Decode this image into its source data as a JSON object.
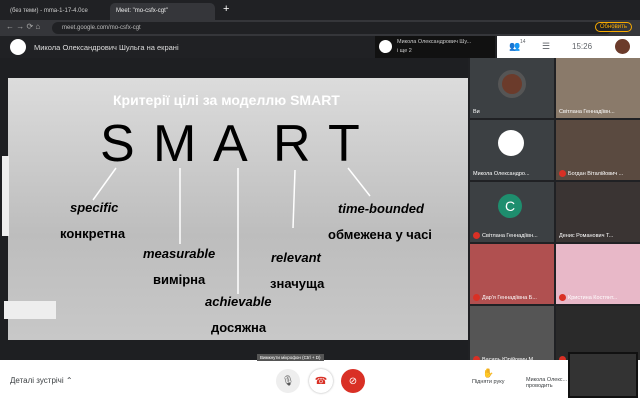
{
  "browser": {
    "tabs": [
      {
        "label": "(без теми) - mma-1-17-4.0ce"
      },
      {
        "label": "Meet: \"mo-csfx-cgt\""
      }
    ],
    "url": "meet.google.com/mo-csfx-cgt",
    "update_label": "Обновить"
  },
  "meet": {
    "presenter_banner": "Микола Олександрович Шульга на екрані",
    "presenting_name": "Микола Олександрович Шу...",
    "presenting_sub": "і ще 2",
    "participant_count": "14",
    "time": "15:26",
    "self_label": "Ви"
  },
  "slide": {
    "title": "Критерії цілі за моделлю SMART",
    "letters": [
      "S",
      "M",
      "A",
      "R",
      "T"
    ],
    "terms": [
      {
        "en": "specific",
        "ua": "конкретна"
      },
      {
        "en": "measurable",
        "ua": "вимірна"
      },
      {
        "en": "achievable",
        "ua": "досяжна"
      },
      {
        "en": "relevant",
        "ua": "значуща"
      },
      {
        "en": "time-bounded",
        "ua": "обмежена у часі"
      }
    ]
  },
  "participants": [
    {
      "name": "Ви",
      "type": "avatar"
    },
    {
      "name": "Світлана Геннадіївн...",
      "type": "video"
    },
    {
      "name": "Микола Олександро...",
      "type": "logo"
    },
    {
      "name": "Богдан Віталійович ...",
      "type": "video"
    },
    {
      "name": "Світлана Геннадіївн...",
      "type": "letter",
      "letter": "C"
    },
    {
      "name": "Денис Романович Т...",
      "type": "video"
    },
    {
      "name": "Дар'я Геннадіївна Б...",
      "type": "video"
    },
    {
      "name": "Кристина Костянт...",
      "type": "video"
    },
    {
      "name": "Василь Юрійович М...",
      "type": "video"
    },
    {
      "name": "",
      "type": "video"
    }
  ],
  "controls": {
    "details": "Деталі зустрічі",
    "tooltip": "Вимкнути мікрофон (Ctrl + D)",
    "raise_hand": "Підняти руку",
    "presenting": "Микола Олекс... проводить"
  }
}
